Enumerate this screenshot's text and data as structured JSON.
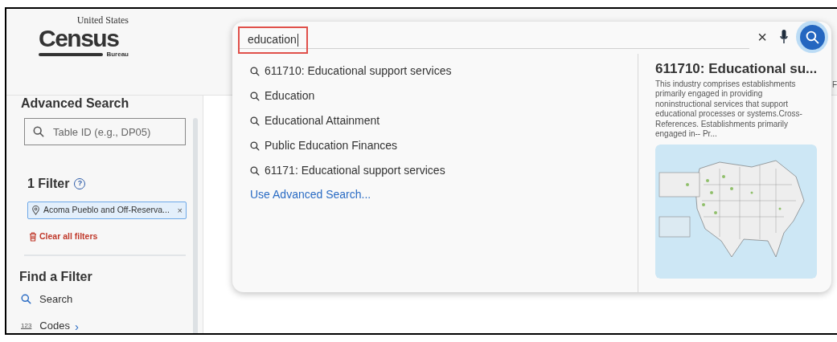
{
  "logo": {
    "top": "United States",
    "main": "Census",
    "bottom": "Bureau"
  },
  "sidebar": {
    "advanced_search": {
      "title": "Advanced Search",
      "placeholder": "Table ID (e.g., DP05)"
    },
    "filters": {
      "title": "1 Filter",
      "help": "?",
      "chips": [
        {
          "label": "Acoma Pueblo and Off-Reserva...",
          "remove": "×"
        }
      ],
      "clear": "Clear all filters"
    },
    "find_filter": {
      "title": "Find a Filter",
      "items": [
        {
          "kind": "search",
          "label": "Search"
        },
        {
          "kind": "codes",
          "label": "Codes",
          "badge": "123",
          "chevron": "›"
        }
      ]
    }
  },
  "search": {
    "value": "education",
    "clear": "×",
    "suggestions": [
      "611710: Educational support services",
      "Education",
      "Educational Attainment",
      "Public Education Finances",
      "61171: Educational support services"
    ],
    "advanced_link": "Use Advanced Search...",
    "preview": {
      "title": "611710: Educational su...",
      "description": "This industry comprises establishments primarily engaged in providing noninstructional services that support educational processes or systems.Cross-References. Establishments primarily engaged in-- Pr..."
    }
  },
  "header_cut_text": "F"
}
